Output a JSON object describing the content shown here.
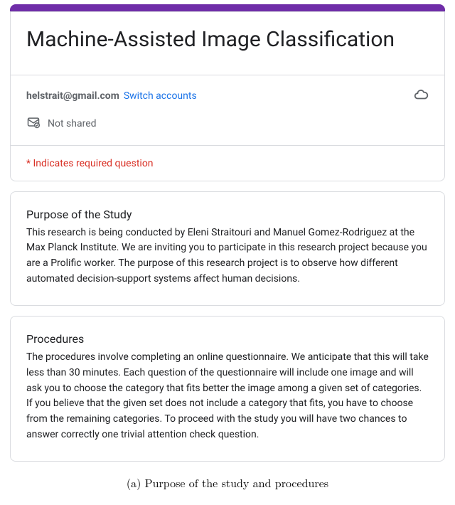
{
  "header": {
    "title": "Machine-Assisted Image Classification",
    "email": "helstrait@gmail.com",
    "switch_link": "Switch accounts",
    "not_shared": "Not shared",
    "required_note": "* Indicates required question"
  },
  "sections": {
    "purpose": {
      "title": "Purpose of the Study",
      "body": "This research is being conducted by Eleni Straitouri and Manuel Gomez-Rodriguez at the Max Planck Institute. We are inviting you to participate in this research project because you are a Prolific worker. The purpose of this research project is to observe how different automated decision-support systems affect human decisions."
    },
    "procedures": {
      "title": "Procedures",
      "body": "The procedures involve completing an online questionnaire. We anticipate that this will take less than 30 minutes. Each question of the questionnaire will include one image and will ask you to choose the category that fits better the image among a given set of categories. If you believe that the given set does not include a category that fits, you have to choose from the remaining categories. To proceed with the study you will have two chances to answer correctly one trivial attention check question."
    }
  },
  "caption": "(a) Purpose of the study and procedures"
}
